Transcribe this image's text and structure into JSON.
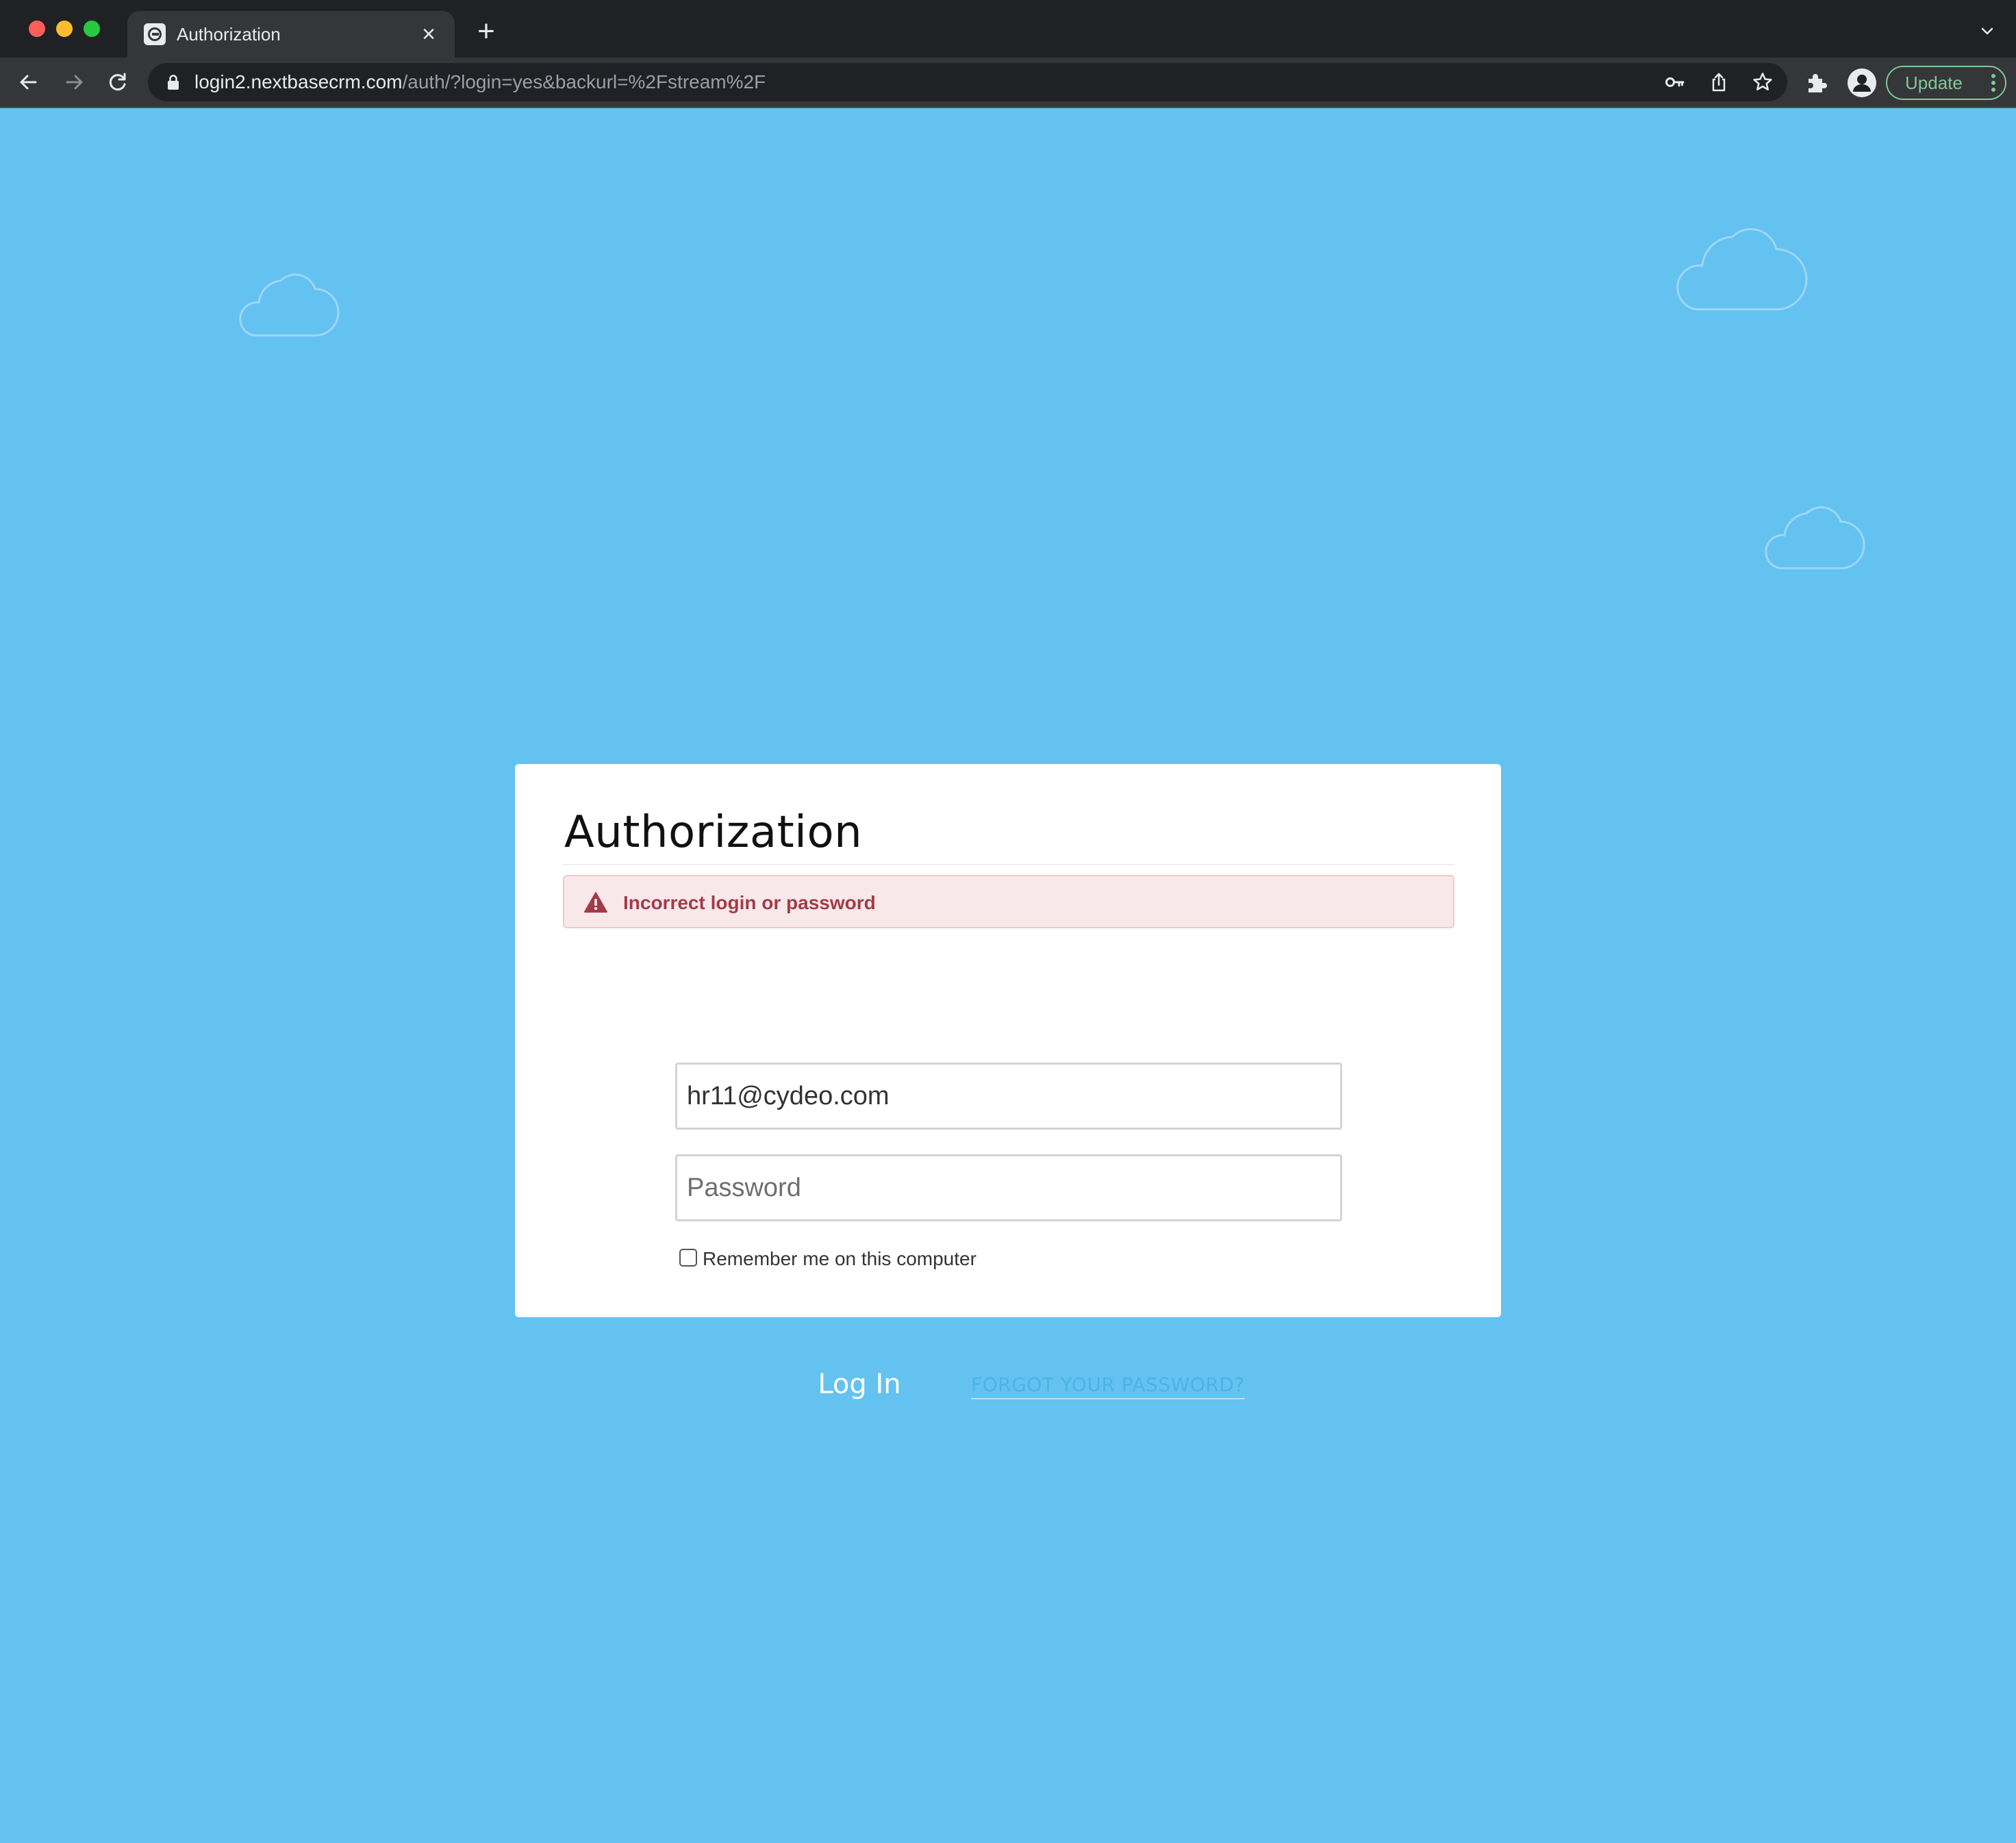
{
  "browser": {
    "tab": {
      "title": "Authorization",
      "close_glyph": "×",
      "favicon": "nextbase-logo-icon"
    },
    "new_tab_glyph": "+",
    "omnibox": {
      "url_host": "login2.nextbasecrm.com",
      "url_path": "/auth/?login=yes&backurl=%2Fstream%2F"
    },
    "update_label": "Update",
    "colors": {
      "chrome_dark": "#202124",
      "chrome_toolbar": "#35363a",
      "update_green": "#81c995"
    }
  },
  "page": {
    "background_color": "#64c2f1",
    "card": {
      "title": "Authorization",
      "alert": {
        "text": "Incorrect login or password",
        "color": "#a23b49",
        "icon": "warning-triangle-icon"
      },
      "login_field": {
        "value": "hr11@cydeo.com"
      },
      "password_field": {
        "placeholder": "Password",
        "value": ""
      },
      "remember_label": "Remember me on this computer",
      "remember_checked": false,
      "login_button_label": "Log In",
      "forgot_link": "FORGOT YOUR PASSWORD?",
      "accent_color": "#64c2f1"
    }
  }
}
